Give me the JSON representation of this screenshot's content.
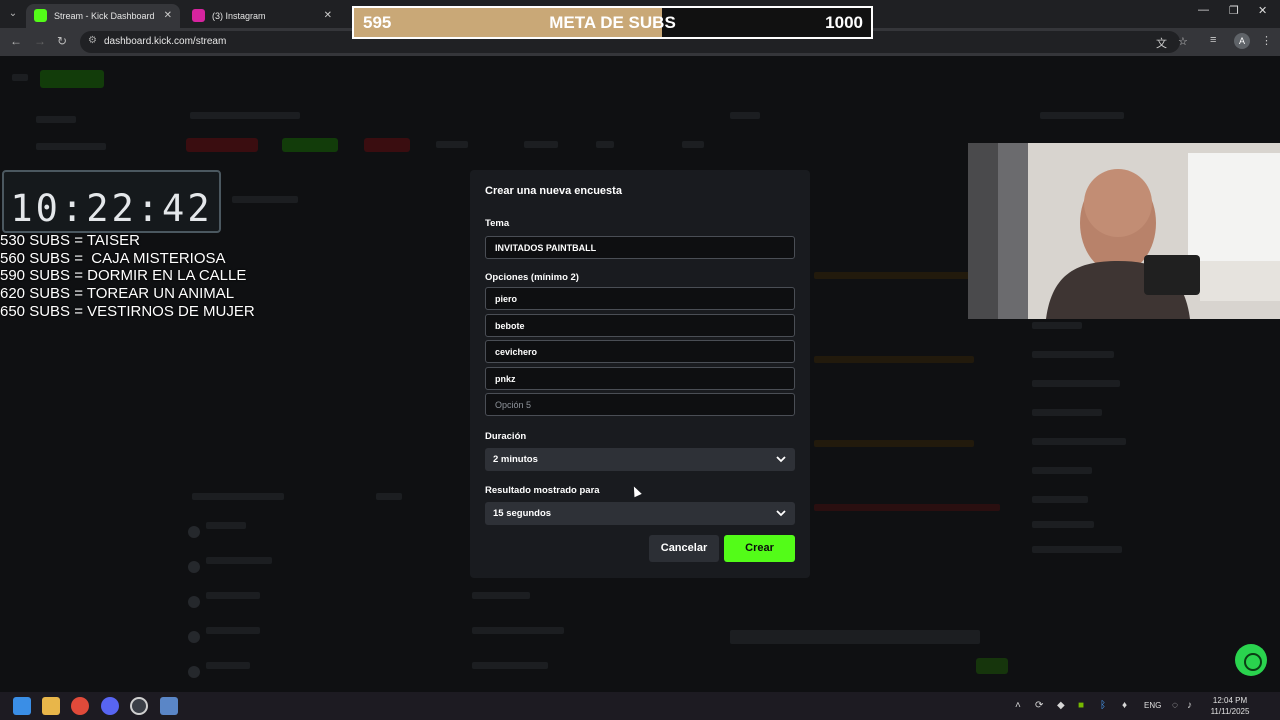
{
  "browser": {
    "tabs": [
      {
        "title": "Stream - Kick Dashboard",
        "close": "✕",
        "favicon_color": "#53fc18"
      },
      {
        "title": "(3) Instagram",
        "close": "✕",
        "favicon_color": "#d6249f"
      }
    ],
    "url": "dashboard.kick.com/stream"
  },
  "sub_goal": {
    "current": "595",
    "title": "META DE SUBS",
    "target": "1000",
    "progress": 0.595
  },
  "stream_clock": {
    "time": "10:22:42"
  },
  "sub_goals": [
    "530 SUBS = TAISER",
    "560 SUBS =  CAJA MISTERIOSA",
    "590 SUBS = DORMIR EN LA CALLE",
    "620 SUBS = TOREAR UN ANIMAL",
    "650 SUBS = VESTIRNOS DE MUJER"
  ],
  "poll_modal": {
    "title": "Crear una nueva encuesta",
    "topic_label": "Tema",
    "topic_value": "INVITADOS PAINTBALL",
    "options_label": "Opciones (mínimo 2)",
    "options": [
      "piero",
      "bebote",
      "cevichero",
      "pnkz"
    ],
    "option_placeholder": "Opción 5",
    "duration_label": "Duración",
    "duration_value": "2 minutos",
    "result_label": "Resultado mostrado para",
    "result_value": "15 segundos",
    "cancel_label": "Cancelar",
    "create_label": "Crear"
  },
  "taskbar": {
    "language": "ENG",
    "time": "12:04 PM",
    "date": "11/11/2025"
  },
  "colors": {
    "kick_green": "#53fc18",
    "goal_fill": "#c9a877",
    "modal_bg": "#191b1f"
  }
}
